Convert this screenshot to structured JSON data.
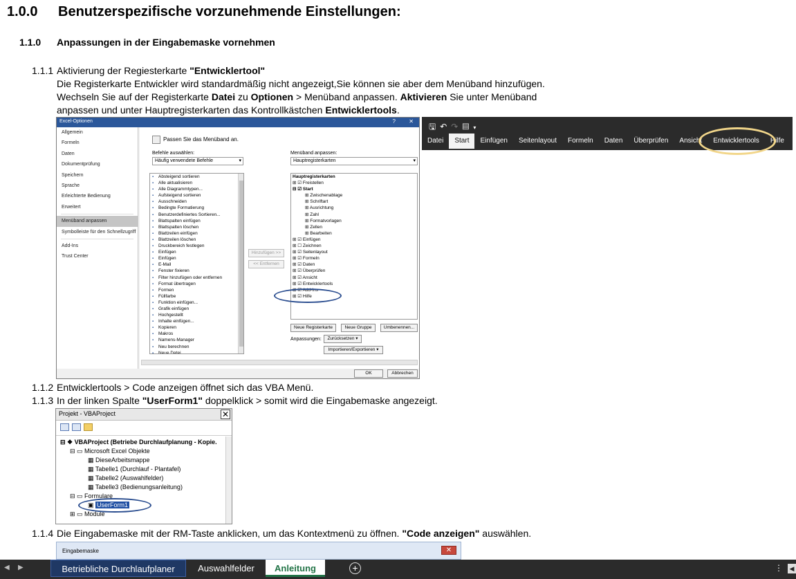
{
  "heading1": {
    "number": "1.0.0",
    "text": "Benutzerspezifische vorzunehmende Einstellungen:"
  },
  "heading2": {
    "number": "1.1.0",
    "text": "Anpassungen in der Eingabemaske vornehmen"
  },
  "step_1_1_1": {
    "number": "1.1.1",
    "prefix": "Aktivierung der Regiesterkarte ",
    "bold": "\"Entwicklertool\"",
    "line1": "Die Registerkarte Entwickler wird standardmäßig nicht angezeigt,Sie können sie aber dem Menüband hinzufügen.",
    "line2_a": "Wechseln Sie auf der Registerkarte ",
    "line2_b": "Datei",
    "line2_c": " zu ",
    "line2_d": "Optionen",
    "line2_e": " > Menüband anpassen. ",
    "line2_f": "Aktivieren",
    "line2_g": " Sie unter Menüband",
    "line3_a": "anpassen und unter Hauptregisterkarten das Kontrollkästchen ",
    "line3_b": "Entwicklertools",
    "line3_c": "."
  },
  "step_1_1_2": {
    "number": "1.1.2",
    "text": "Entwicklertools > Code anzeigen öffnet sich das VBA Menü."
  },
  "step_1_1_3": {
    "number": "1.1.3",
    "prefix": "In der linken Spalte ",
    "bold": "\"UserForm1\"",
    "suffix": " doppelklick > somit wird die Eingabemaske angezeigt."
  },
  "step_1_1_4": {
    "number": "1.1.4",
    "prefix": "Die Eingabemaske mit der RM-Taste anklicken, um das Kontextmenü zu öffnen. ",
    "bold": "\"Code anzeigen\"",
    "suffix": " auswählen."
  },
  "options_dialog": {
    "title": "Excel-Optionen",
    "help": "?",
    "close": "✕",
    "sidebar": [
      "Allgemein",
      "Formeln",
      "Daten",
      "Dokumentprüfung",
      "Speichern",
      "Sprache",
      "Erleichterte Bedienung",
      "Erweitert",
      "Menüband anpassen",
      "Symbolleiste für den Schnellzugriff",
      "Add-Ins",
      "Trust Center"
    ],
    "selected_sidebar": "Menüband anpassen",
    "header": "Passen Sie das Menüband an.",
    "commands_label": "Befehle auswählen:",
    "commands_value": "Häufig verwendete Befehle",
    "ribbon_label": "Menüband anpassen:",
    "ribbon_value": "Hauptregisterkarten",
    "commands": [
      "Absteigend sortieren",
      "Alle aktualisieren",
      "Alle Diagrammtypen...",
      "Aufsteigend sortieren",
      "Ausschneiden",
      "Bedingte Formatierung",
      "Benutzerdefiniertes Sortieren...",
      "Blattspalten einfügen",
      "Blattspalten löschen",
      "Blattzeilen einfügen",
      "Blattzeilen löschen",
      "Druckbereich festlegen",
      "Einfügen",
      "Einfügen",
      "E-Mail",
      "Fenster fixieren",
      "Filter hinzufügen oder entfernen",
      "Format übertragen",
      "Formen",
      "Füllfarbe",
      "Funktion einfügen...",
      "Grafik einfügen",
      "Hochgestellt",
      "Inhalte einfügen...",
      "Kopieren",
      "Makros",
      "Namens-Manager",
      "Neu berechnen",
      "Neue Datei"
    ],
    "add_button": "Hinzufügen >>",
    "remove_button": "<< Entfernen",
    "tree": [
      {
        "label": "Hauptregisterkarten",
        "level": 0,
        "bold": true,
        "prefix": ""
      },
      {
        "label": "Freistellen",
        "level": 0,
        "prefix": "⊞ ☑ "
      },
      {
        "label": "Start",
        "level": 0,
        "prefix": "⊟ ☑ ",
        "bold": true
      },
      {
        "label": "Zwischenablage",
        "level": 2,
        "prefix": "⊞ "
      },
      {
        "label": "Schriftart",
        "level": 2,
        "prefix": "⊞ "
      },
      {
        "label": "Ausrichtung",
        "level": 2,
        "prefix": "⊞ "
      },
      {
        "label": "Zahl",
        "level": 2,
        "prefix": "⊞ "
      },
      {
        "label": "Formatvorlagen",
        "level": 2,
        "prefix": "⊞ "
      },
      {
        "label": "Zellen",
        "level": 2,
        "prefix": "⊞ "
      },
      {
        "label": "Bearbeiten",
        "level": 2,
        "prefix": "⊞ "
      },
      {
        "label": "Einfügen",
        "level": 0,
        "prefix": "⊞ ☑ "
      },
      {
        "label": "Zeichnen",
        "level": 0,
        "prefix": "⊞ ☐ "
      },
      {
        "label": "Seitenlayout",
        "level": 0,
        "prefix": "⊞ ☑ "
      },
      {
        "label": "Formeln",
        "level": 0,
        "prefix": "⊞ ☑ "
      },
      {
        "label": "Daten",
        "level": 0,
        "prefix": "⊞ ☑ "
      },
      {
        "label": "Überprüfen",
        "level": 0,
        "prefix": "⊞ ☑ "
      },
      {
        "label": "Ansicht",
        "level": 0,
        "prefix": "⊞ ☑ "
      },
      {
        "label": "Entwicklertools",
        "level": 0,
        "prefix": "⊞ ☑ "
      },
      {
        "label": "Add-Ins",
        "level": 0,
        "prefix": "⊞ ☑ "
      },
      {
        "label": "Hilfe",
        "level": 0,
        "prefix": "⊞ ☑ "
      }
    ],
    "new_tab_button": "Neue Registerkarte",
    "new_group_button": "Neue Gruppe",
    "rename_button": "Umbenennen...",
    "customizations_label": "Anpassungen:",
    "reset_button": "Zurücksetzen ▾",
    "import_export_button": "Importieren/Exportieren ▾",
    "ok_button": "OK",
    "cancel_button": "Abbrechen"
  },
  "ribbon": {
    "tabs": [
      "Datei",
      "Start",
      "Einfügen",
      "Seitenlayout",
      "Formeln",
      "Daten",
      "Überprüfen",
      "Ansicht",
      "Entwicklertools",
      "Hilfe"
    ],
    "active_tab": "Start",
    "highlight_color": "#f2d68a"
  },
  "vba_project": {
    "title": "Projekt - VBAProject",
    "close": "✕",
    "root": "VBAProject (Betriebe Durchlaufplanung - Kopie.",
    "folder_excel": "Microsoft Excel Objekte",
    "item_workbook": "DieseArbeitsmappe",
    "item_sheet1": "Tabelle1 (Durchlauf - Plantafel)",
    "item_sheet2": "Tabelle2 (Auswahlfelder)",
    "item_sheet3": "Tabelle3 (Bedienungsanleitung)",
    "folder_forms": "Formulare",
    "item_userform": "UserForm1",
    "folder_modules": "Module"
  },
  "eingabemaske": {
    "title": "Eingabemaske",
    "close": "✕"
  },
  "sheet_tabs": {
    "tabs": [
      "Betriebliche Durchlaufplaner",
      "Auswahlfelder",
      "Anleitung"
    ],
    "active": "Anleitung",
    "add": "+",
    "more": "⋮"
  },
  "colors": {
    "excel_green": "#217346",
    "ribbon_dark": "#2b2b2b",
    "dialog_blue": "#2b579a",
    "ellipse_blue": "#2a4d8f"
  }
}
